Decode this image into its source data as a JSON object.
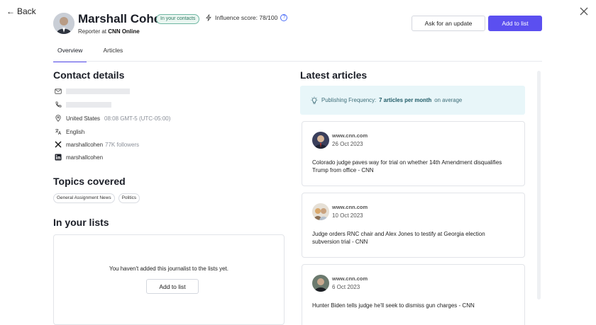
{
  "nav": {
    "back_label": "Back"
  },
  "profile": {
    "name": "Marshall Cohen",
    "contacts_badge": "In your contacts",
    "influence_label": "Influence score: 78/100",
    "role_prefix": "Reporter at",
    "outlet": "CNN Online"
  },
  "actions": {
    "update_label": "Ask for an update",
    "add_label": "Add to list"
  },
  "tabs": [
    {
      "label": "Overview",
      "active": true
    },
    {
      "label": "Articles",
      "active": false
    }
  ],
  "contact": {
    "heading": "Contact details",
    "location": "United States",
    "time": "08:08 GMT-5 (UTC-05:00)",
    "language": "English",
    "x_handle": "marshallcohen",
    "x_followers": "77K followers",
    "linkedin": "marshallcohen"
  },
  "topics": {
    "heading": "Topics covered",
    "items": [
      "General Assignment News",
      "Politics"
    ]
  },
  "lists": {
    "heading": "In your lists",
    "empty_text": "You haven't added this journalist to the lists yet.",
    "add_label": "Add to list"
  },
  "latest": {
    "heading": "Latest articles",
    "freq_prefix": "Publishing Frequency:",
    "freq_value": "7 articles per month",
    "freq_suffix": "on average",
    "articles": [
      {
        "source": "www.cnn.com",
        "date": "26 Oct 2023",
        "title": "Colorado judge paves way for trial on whether 14th Amendment disqualifies Trump from office - CNN"
      },
      {
        "source": "www.cnn.com",
        "date": "10 Oct 2023",
        "title": "Judge orders RNC chair and Alex Jones to testify at Georgia election subversion trial - CNN"
      },
      {
        "source": "www.cnn.com",
        "date": "6 Oct 2023",
        "title": "Hunter Biden tells judge he'll seek to dismiss gun charges - CNN"
      }
    ]
  },
  "icons": {
    "mail": "mail-icon",
    "phone": "phone-icon",
    "location": "location-pin-icon",
    "language": "language-icon",
    "x": "x-logo-icon",
    "linkedin": "linkedin-icon",
    "bolt": "lightning-icon",
    "bulb": "lightbulb-icon",
    "close": "close-icon"
  },
  "colors": {
    "accent": "#5b4ff0",
    "badge_green": "#2f7a63",
    "freq_bg": "#e8f6f9"
  }
}
